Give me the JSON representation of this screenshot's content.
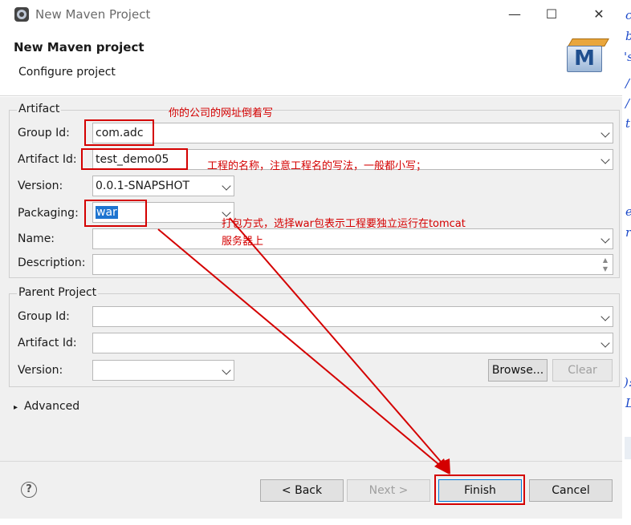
{
  "window": {
    "title": "New Maven Project"
  },
  "header": {
    "title": "New Maven project",
    "subtitle": "Configure project",
    "logo_letter": "M"
  },
  "artifact": {
    "group_label": "Artifact",
    "group_id": {
      "label": "Group Id:",
      "value": "com.adc"
    },
    "artifact_id": {
      "label": "Artifact Id:",
      "value": "test_demo05"
    },
    "version": {
      "label": "Version:",
      "value": "0.0.1-SNAPSHOT"
    },
    "packaging": {
      "label": "Packaging:",
      "value": "war"
    },
    "name": {
      "label": "Name:",
      "value": ""
    },
    "description": {
      "label": "Description:",
      "value": ""
    }
  },
  "parent": {
    "group_label": "Parent Project",
    "group_id": {
      "label": "Group Id:",
      "value": ""
    },
    "artifact_id": {
      "label": "Artifact Id:",
      "value": ""
    },
    "version": {
      "label": "Version:",
      "value": ""
    },
    "browse_label": "Browse...",
    "clear_label": "Clear"
  },
  "advanced_label": "Advanced",
  "buttons": {
    "back": "< Back",
    "next": "Next >",
    "finish": "Finish",
    "cancel": "Cancel"
  },
  "annotations": {
    "group_note": "你的公司的网址倒着写",
    "artifact_note": "工程的名称，注意工程名的写法，一般都小写；",
    "packaging_note_1": "打包方式，选择war包表示工程要独立运行在tomcat",
    "packaging_note_2": "服务器上"
  },
  "side_fragments": [
    "c",
    "b",
    "'s",
    "/",
    "/",
    "t",
    "e",
    "r",
    "):",
    "L"
  ],
  "colors": {
    "annotation": "#d40000",
    "selection": "#1e74d0",
    "side_text": "#1c49c9"
  }
}
